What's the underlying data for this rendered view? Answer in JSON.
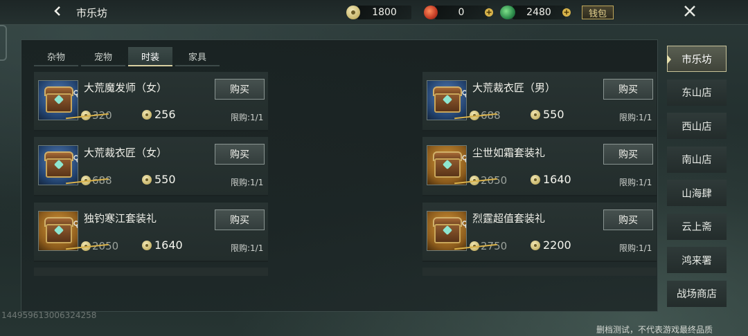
{
  "header": {
    "title": "市乐坊",
    "back_icon": "chevron-left-icon",
    "currencies": [
      {
        "icon": "coin-icon",
        "value": "1800"
      },
      {
        "icon": "red-orb-icon",
        "value": "0"
      },
      {
        "icon": "jade-orb-icon",
        "value": "2480"
      }
    ],
    "wallet_label": "钱包",
    "close_icon": "close-icon"
  },
  "tabs": [
    {
      "label": "杂物",
      "active": false
    },
    {
      "label": "宠物",
      "active": false
    },
    {
      "label": "时装",
      "active": true
    },
    {
      "label": "家具",
      "active": false
    }
  ],
  "buy_label": "购买",
  "items": [
    {
      "name": "大荒魔发师（女）",
      "qty": "1",
      "old_price": "320",
      "price": "256",
      "limit": "限购:1/1",
      "theme": "blue"
    },
    {
      "name": "大荒裁衣匠（男）",
      "qty": "1",
      "old_price": "688",
      "price": "550",
      "limit": "限购:1/1",
      "theme": "blue"
    },
    {
      "name": "大荒裁衣匠（女）",
      "qty": "1",
      "old_price": "688",
      "price": "550",
      "limit": "限购:1/1",
      "theme": "blue"
    },
    {
      "name": "尘世如霜套装礼",
      "qty": "1",
      "old_price": "2050",
      "price": "1640",
      "limit": "限购:1/1",
      "theme": "gold"
    },
    {
      "name": "独钓寒江套装礼",
      "qty": "1",
      "old_price": "2050",
      "price": "1640",
      "limit": "限购:1/1",
      "theme": "gold"
    },
    {
      "name": "烈霆超值套装礼",
      "qty": "1",
      "old_price": "2750",
      "price": "2200",
      "limit": "限购:1/1",
      "theme": "gold"
    }
  ],
  "shops": [
    {
      "label": "市乐坊",
      "active": true
    },
    {
      "label": "东山店",
      "active": false
    },
    {
      "label": "西山店",
      "active": false
    },
    {
      "label": "南山店",
      "active": false
    },
    {
      "label": "山海肆",
      "active": false
    },
    {
      "label": "云上斋",
      "active": false
    },
    {
      "label": "鸿来署",
      "active": false
    },
    {
      "label": "战场商店",
      "active": false
    }
  ],
  "footer": {
    "id_text": "1449596130063242​58",
    "disclaimer": "删档测试，不代表游戏最终品质"
  },
  "colors": {
    "accent_gold": "#d9b14a",
    "active_border": "#c9c39a",
    "background": "#23302f"
  }
}
